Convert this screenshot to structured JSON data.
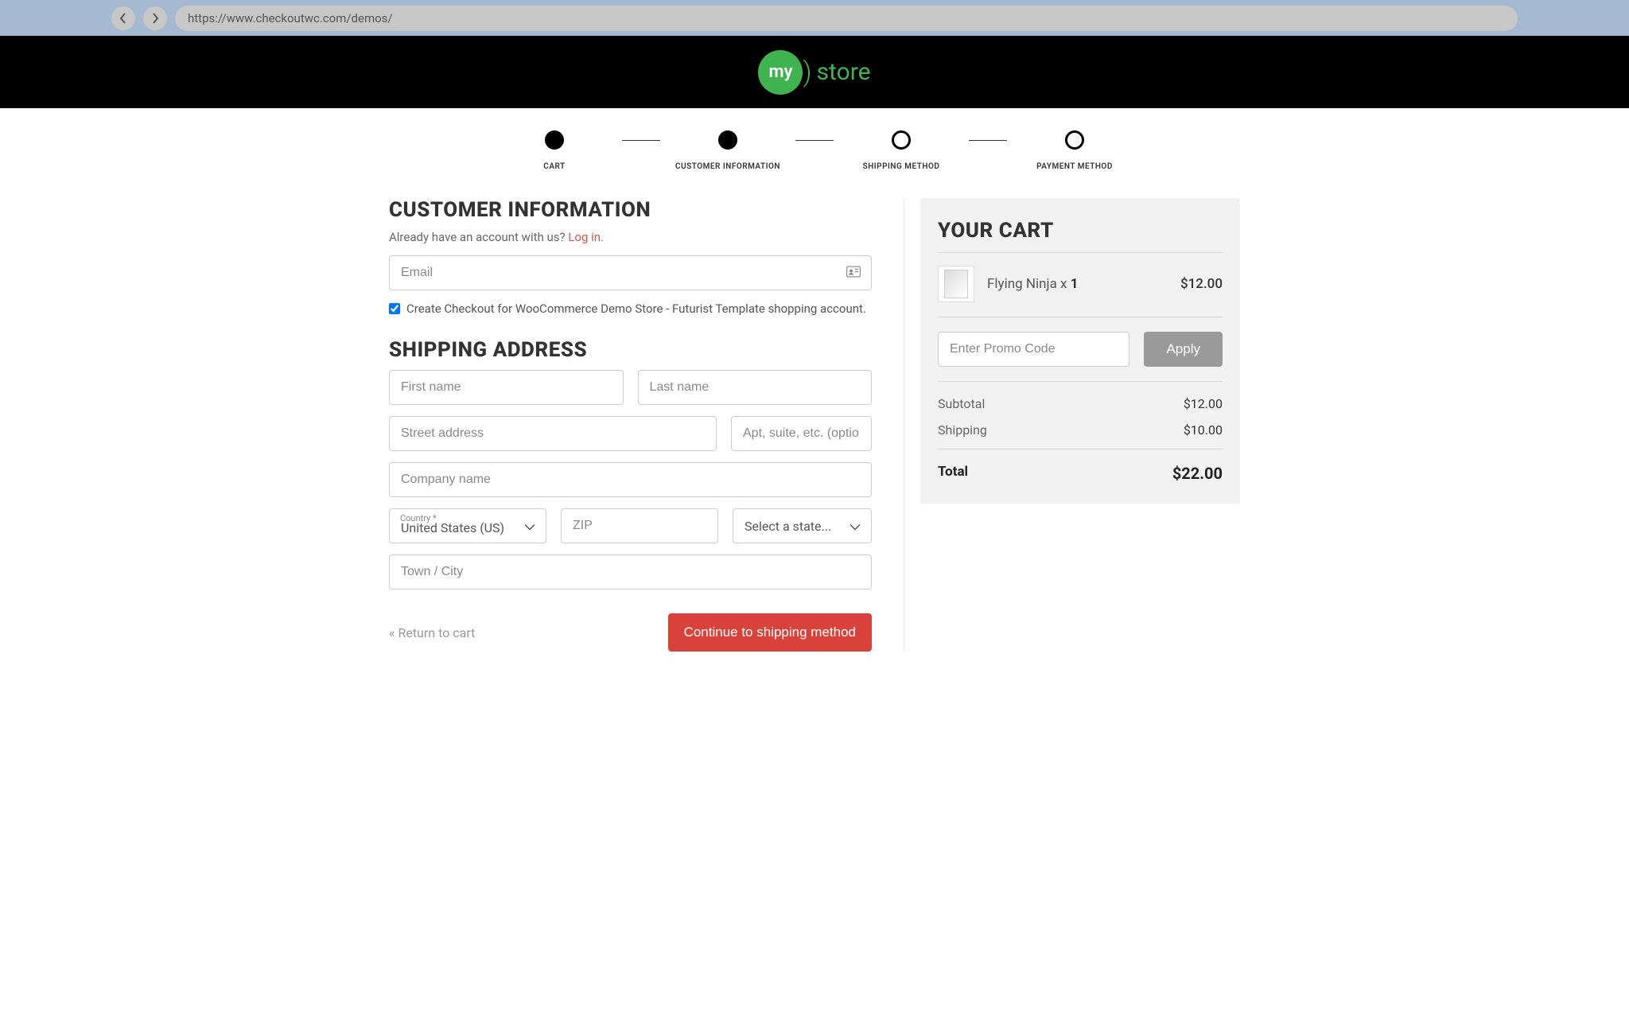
{
  "browser": {
    "url": "https://www.checkoutwc.com/demos/"
  },
  "logo": {
    "circle": "my",
    "text": "store"
  },
  "stepper": {
    "steps": [
      {
        "label": "CART",
        "filled": true
      },
      {
        "label": "CUSTOMER INFORMATION",
        "filled": true
      },
      {
        "label": "SHIPPING METHOD",
        "filled": false
      },
      {
        "label": "PAYMENT METHOD",
        "filled": false
      }
    ]
  },
  "customer": {
    "heading": "CUSTOMER INFORMATION",
    "prompt_pre": "Already have an account with us? ",
    "prompt_link": "Log in.",
    "email_placeholder": "Email",
    "create_label": "Create Checkout for WooCommerce Demo Store - Futurist Template shopping account."
  },
  "shipping": {
    "heading": "SHIPPING ADDRESS",
    "first_name": "First name",
    "last_name": "Last name",
    "street": "Street address",
    "apt": "Apt, suite, etc. (optional)",
    "company": "Company name",
    "country_label": "Country *",
    "country_value": "United States (US)",
    "zip": "ZIP",
    "state_placeholder": "Select a state...",
    "city": "Town / City"
  },
  "actions": {
    "return": "« Return to cart",
    "continue": "Continue to shipping method"
  },
  "cart": {
    "heading": "YOUR CART",
    "item_name": "Flying Ninja x ",
    "item_qty": "1",
    "item_price": "$12.00",
    "promo_placeholder": "Enter Promo Code",
    "apply": "Apply",
    "subtotal_label": "Subtotal",
    "subtotal_value": "$12.00",
    "shipping_label": "Shipping",
    "shipping_value": "$10.00",
    "total_label": "Total",
    "total_value": "$22.00"
  }
}
